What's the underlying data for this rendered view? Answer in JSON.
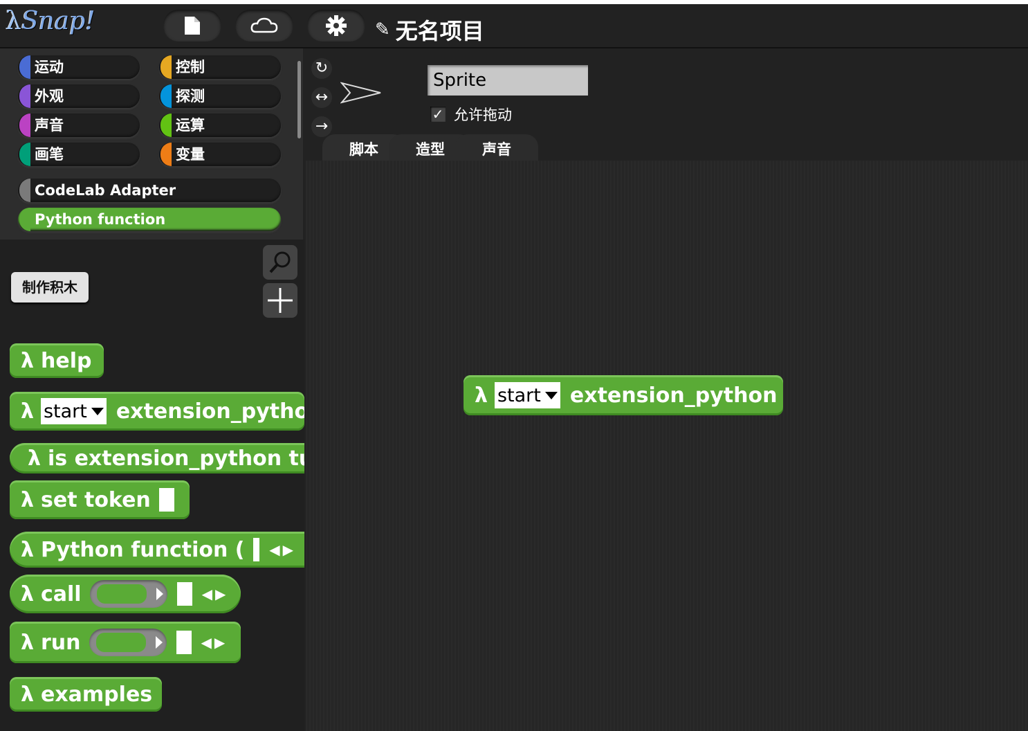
{
  "app": {
    "logo": "Snap!",
    "project_title": "无名项目"
  },
  "toolbar": {
    "file_icon": "file-icon",
    "cloud_icon": "cloud-icon",
    "settings_icon": "gear-icon",
    "edit_icon": "pencil-icon"
  },
  "categories": [
    {
      "label": "运动",
      "color": "#4a6cd4"
    },
    {
      "label": "控制",
      "color": "#e6a822"
    },
    {
      "label": "外观",
      "color": "#8a55d7"
    },
    {
      "label": "探测",
      "color": "#0494dc"
    },
    {
      "label": "声音",
      "color": "#bb42c3"
    },
    {
      "label": "运算",
      "color": "#62c213"
    },
    {
      "label": "画笔",
      "color": "#009f79"
    },
    {
      "label": "变量",
      "color": "#ee7d16"
    }
  ],
  "extensions": [
    {
      "label": "CodeLab Adapter",
      "color": "#7a7a7a"
    },
    {
      "label": "Python function",
      "color": "#5aab36"
    }
  ],
  "palette": {
    "make_block": "制作积木",
    "search_icon": "magnifier-icon",
    "add_icon": "plus-icon",
    "blocks": [
      {
        "lambda": "λ",
        "text": "help"
      },
      {
        "lambda": "λ",
        "dropdown": "start",
        "text": "extension_pytho"
      },
      {
        "lambda": "λ",
        "text": "is extension_python tu"
      },
      {
        "lambda": "λ",
        "text": "set token"
      },
      {
        "lambda": "λ",
        "text": "Python function ("
      },
      {
        "lambda": "λ",
        "text": "call"
      },
      {
        "lambda": "λ",
        "text": "run"
      },
      {
        "lambda": "λ",
        "text": "examples"
      }
    ]
  },
  "sprite": {
    "name": "Sprite",
    "allow_drag_label": "允许拖动",
    "allow_drag_checked": "✓",
    "rotation_icons": [
      "↻",
      "↔",
      "→"
    ]
  },
  "tabs": [
    "脚本",
    "造型",
    "声音"
  ],
  "script": {
    "lambda": "λ",
    "dropdown": "start",
    "text": "extension_python"
  },
  "colors": {
    "block_green": "#5aab36",
    "background": "#222222"
  }
}
